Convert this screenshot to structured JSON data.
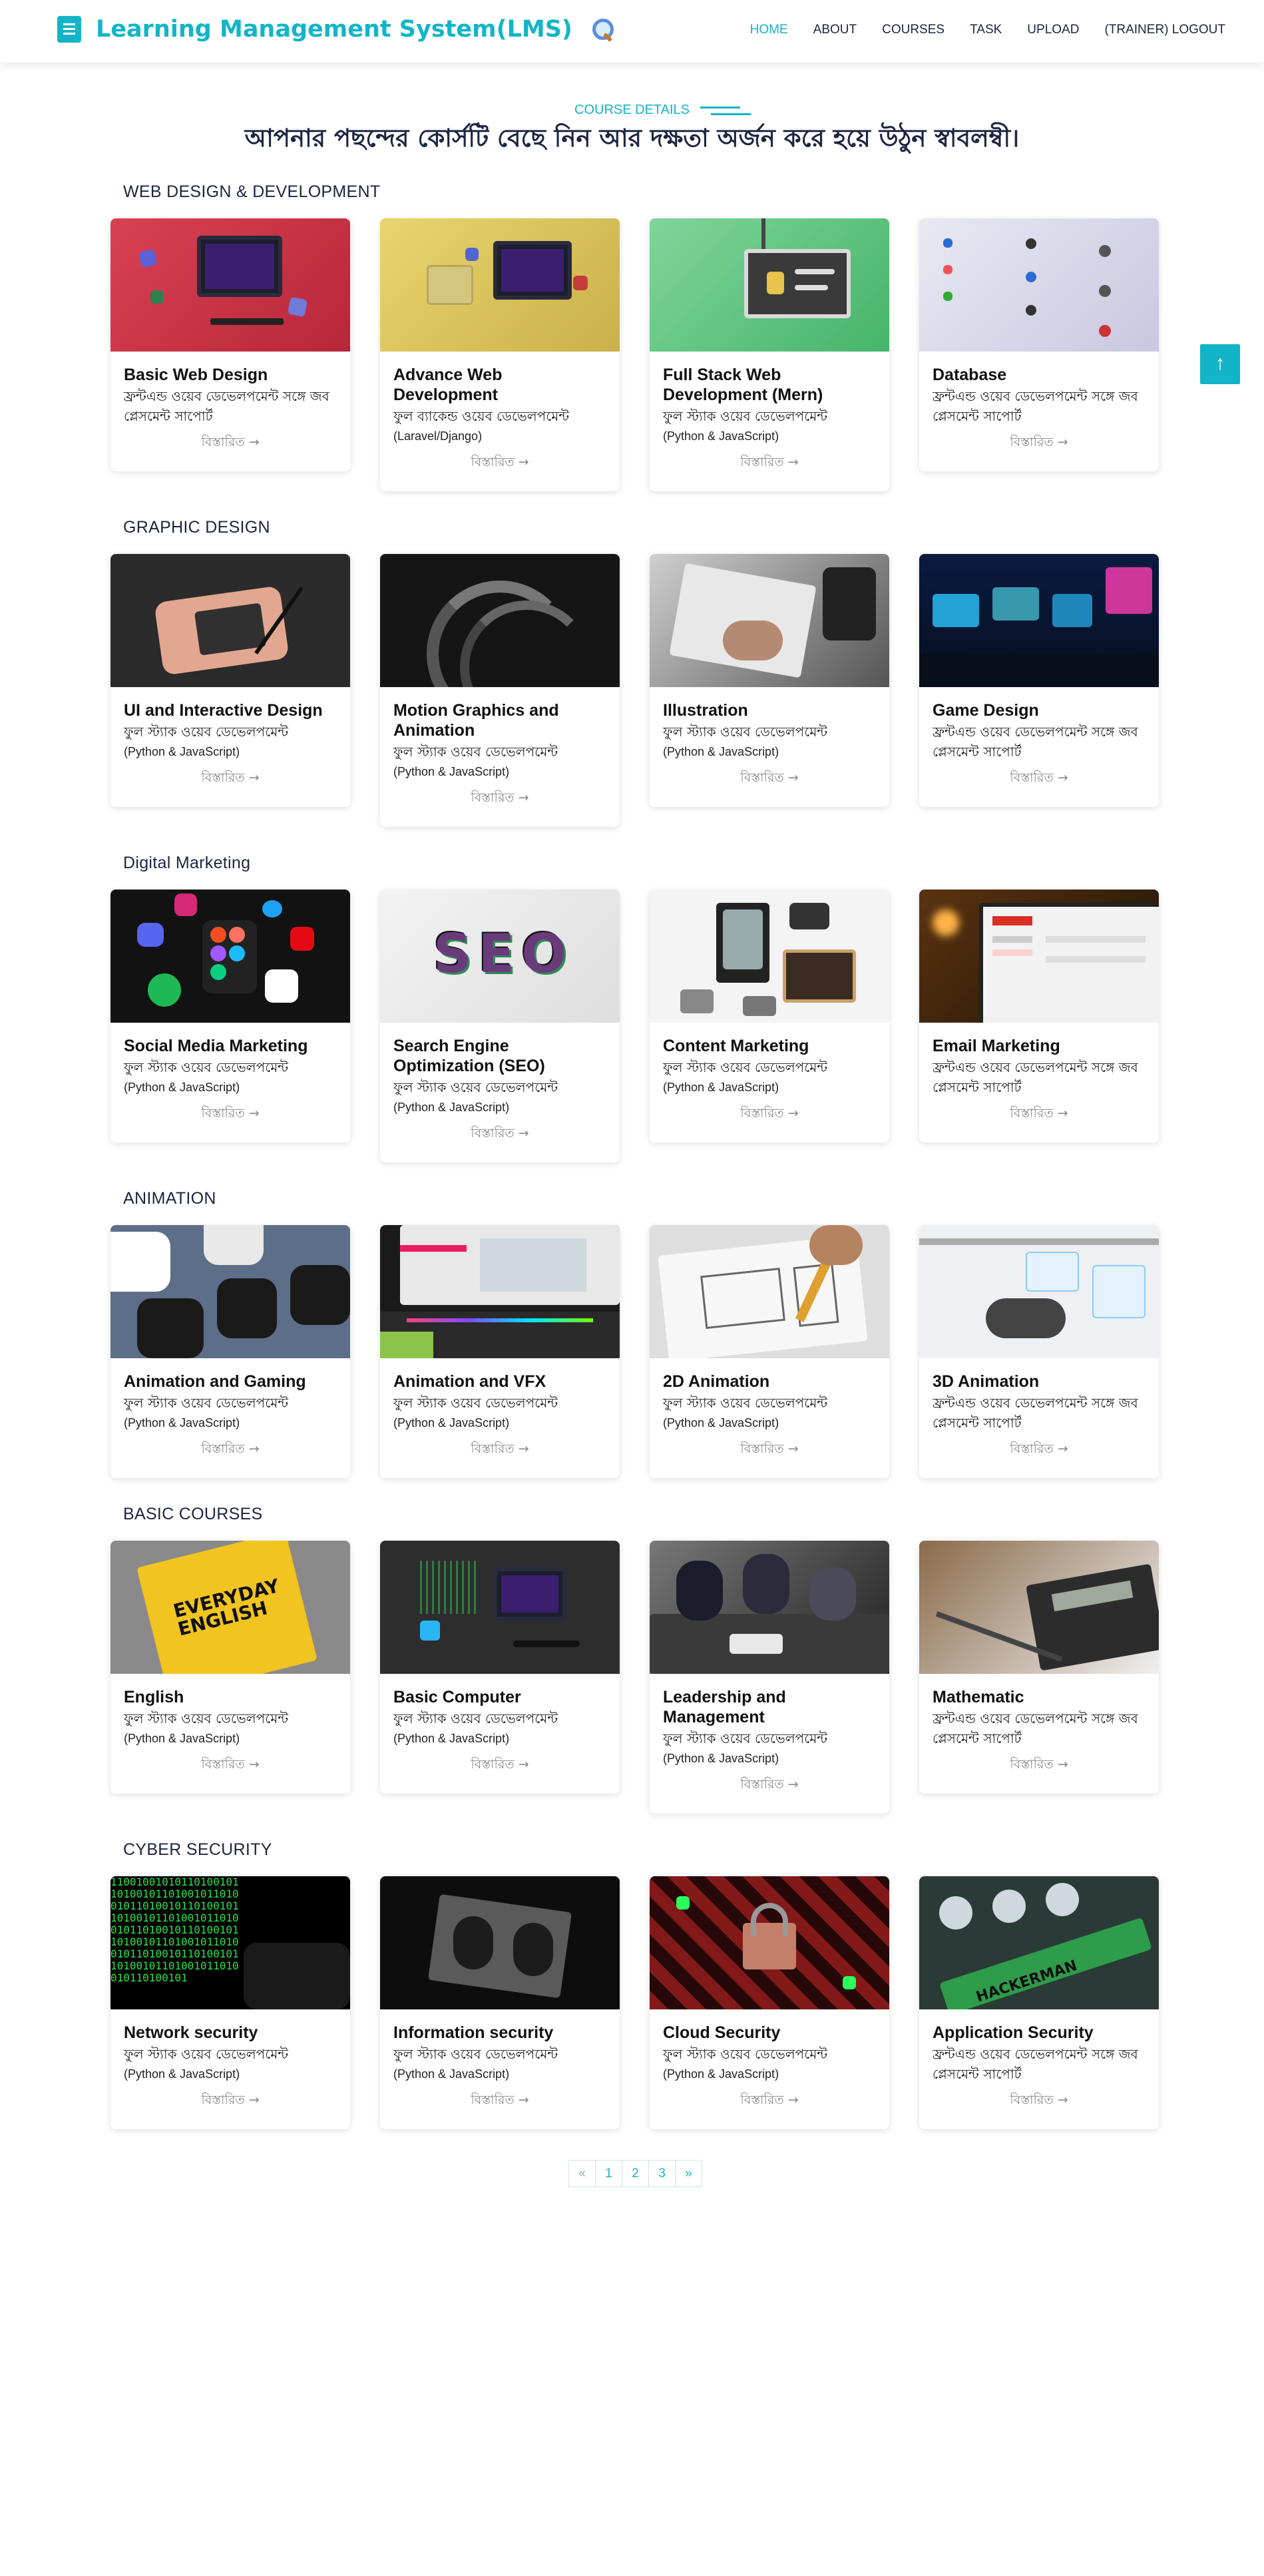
{
  "brand": {
    "title": "Learning Management System(LMS)"
  },
  "nav": [
    {
      "label": "HOME",
      "active": true
    },
    {
      "label": "ABOUT"
    },
    {
      "label": "COURSES"
    },
    {
      "label": "TASK"
    },
    {
      "label": "UPLOAD"
    },
    {
      "label": "(TRAINER) LOGOUT"
    }
  ],
  "section": {
    "label": "COURSE DETAILS",
    "title": "আপনার পছন্দের কোর্সটি বেছে নিন আর দক্ষতা অর্জন করে হয়ে উঠুন স্বাবলম্বী।"
  },
  "more_label": "বিস্তারিত →",
  "categories": [
    {
      "title": "WEB DESIGN & DEVELOPMENT",
      "courses": [
        {
          "title": "Basic Web Design",
          "desc": "ফ্রন্টএন্ড ওয়েব ডেভেলপমেন্ট সঙ্গে জব প্লেসমেন্ট সাপোর্ট",
          "sub": "",
          "image": "red-computer-image"
        },
        {
          "title": "Advance Web Development",
          "desc": "ফুল ব্যাকেন্ড ওয়েব ডেভেলপমেন্ট",
          "sub": "(Laravel/Django)",
          "image": "yellow-computer-image"
        },
        {
          "title": "Full Stack Web Development (Mern)",
          "desc": "ফুল স্ট্যাক ওয়েব ডেভেলপমেন্ট",
          "sub": "(Python & JavaScript)",
          "image": "green-screen-image"
        },
        {
          "title": "Database",
          "desc": "ফ্রন্টএন্ড ওয়েব ডেভেলপমেন্ট সঙ্গে জব প্লেসমেন্ট সাপোর্ট",
          "sub": "",
          "image": "database-icons-image"
        }
      ]
    },
    {
      "title": "GRAPHIC DESIGN",
      "courses": [
        {
          "title": "UI and Interactive Design",
          "desc": "ফুল স্ট্যাক ওয়েব ডেভেলপমেন্ট",
          "sub": "(Python & JavaScript)",
          "image": "drawing-tablet-image"
        },
        {
          "title": "Motion Graphics and Animation",
          "desc": "ফুল স্ট্যাক ওয়েব ডেভেলপমেন্ট",
          "sub": "(Python & JavaScript)",
          "image": "curled-paper-image"
        },
        {
          "title": "Illustration",
          "desc": "ফুল স্ট্যাক ওয়েব ডেভেলপমেন্ট",
          "sub": "(Python & JavaScript)",
          "image": "sketching-hand-image"
        },
        {
          "title": "Game Design",
          "desc": "ফ্রন্টএন্ড ওয়েব ডেভেলপমেন্ট সঙ্গে জব প্লেসমেন্ট সাপোর্ট",
          "sub": "",
          "image": "neon-arcade-image"
        }
      ]
    },
    {
      "title": "Digital Marketing",
      "courses": [
        {
          "title": "Social Media Marketing",
          "desc": "ফুল স্ট্যাক ওয়েব ডেভেলপমেন্ট",
          "sub": "(Python & JavaScript)",
          "image": "social-apps-image"
        },
        {
          "title": "Search Engine Optimization (SEO)",
          "desc": "ফুল স্ট্যাক ওয়েব ডেভেলপমেন্ট",
          "sub": "(Python & JavaScript)",
          "image": "seo-letters-image"
        },
        {
          "title": "Content Marketing",
          "desc": "ফুল স্ট্যাক ওয়েব ডেভেলপমেন্ট",
          "sub": "(Python & JavaScript)",
          "image": "creator-desk-image"
        },
        {
          "title": "Email Marketing",
          "desc": "ফ্রন্টএন্ড ওয়েব ডেভেলপমেন্ট সঙ্গে জব প্লেসমেন্ট সাপোর্ট",
          "sub": "",
          "image": "gmail-laptop-image"
        }
      ]
    },
    {
      "title": "ANIMATION",
      "courses": [
        {
          "title": "Animation and Gaming",
          "desc": "ফুল স্ট্যাক ওয়েব ডেভেলপমেন্ট",
          "sub": "(Python & JavaScript)",
          "image": "app-icons-image"
        },
        {
          "title": "Animation and VFX",
          "desc": "ফুল স্ট্যাক ওয়েব ডেভেলপমেন্ট",
          "sub": "(Python & JavaScript)",
          "image": "laptop-vfx-image"
        },
        {
          "title": "2D Animation",
          "desc": "ফুল স্ট্যাক ওয়েব ডেভেলপমেন্ট",
          "sub": "(Python & JavaScript)",
          "image": "wireframe-sketch-image"
        },
        {
          "title": "3D Animation",
          "desc": "ফ্রন্টএন্ড ওয়েব ডেভেলপমেন্ট সঙ্গে জব প্লেসমেন্ট সাপোর্ট",
          "sub": "",
          "image": "whiteboard-image"
        }
      ]
    },
    {
      "title": "BASIC COURSES",
      "courses": [
        {
          "title": "English",
          "desc": "ফুল স্ট্যাক ওয়েব ডেভেলপমেন্ট",
          "sub": "(Python & JavaScript)",
          "image": "english-book-image"
        },
        {
          "title": "Basic Computer",
          "desc": "ফুল স্ট্যাক ওয়েব ডেভেলপমেন্ট",
          "sub": "(Python & JavaScript)",
          "image": "dark-computer-image"
        },
        {
          "title": "Leadership and Management",
          "desc": "ফুল স্ট্যাক ওয়েব ডেভেলপমেন্ট",
          "sub": "(Python & JavaScript)",
          "image": "meeting-image"
        },
        {
          "title": "Mathematic",
          "desc": "ফ্রন্টএন্ড ওয়েব ডেভেলপমেন্ট সঙ্গে জব প্লেসমেন্ট সাপোর্ট",
          "sub": "",
          "image": "calculator-image"
        }
      ]
    },
    {
      "title": "CYBER SECURITY",
      "courses": [
        {
          "title": "Network security",
          "desc": "ফুল স্ট্যাক ওয়েব ডেভেলপমেন্ট",
          "sub": "(Python & JavaScript)",
          "image": "binary-code-image"
        },
        {
          "title": "Information security",
          "desc": "ফুল স্ট্যাক ওয়েব ডেভেলপমেন্ট",
          "sub": "(Python & JavaScript)",
          "image": "hacker-laptop-image"
        },
        {
          "title": "Cloud Security",
          "desc": "ফুল স্ট্যাক ওয়েব ডেভেলপমেন্ট",
          "sub": "(Python & JavaScript)",
          "image": "padlock-image"
        },
        {
          "title": "Application Security",
          "desc": "ফ্রন্টএন্ড ওয়েব ডেভেলপমেন্ট সঙ্গে জব প্লেসমেন্ট সাপোর্ট",
          "sub": "",
          "image": "hackerman-keyboard-image"
        }
      ]
    }
  ],
  "pagination": [
    "«",
    "1",
    "2",
    "3",
    "»"
  ],
  "scroll_top": {
    "icon": "arrow-up-icon",
    "glyph": "↑"
  },
  "colors": {
    "accent": "#12b5c7",
    "heading": "#1c2541"
  }
}
